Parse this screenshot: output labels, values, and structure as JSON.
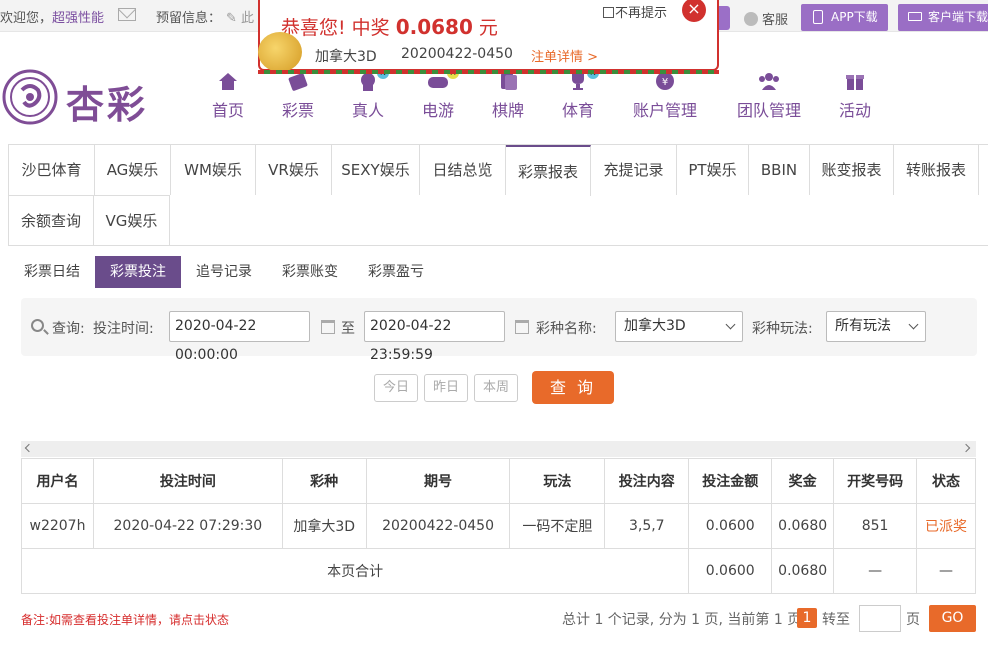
{
  "topbar": {
    "welcome": "欢迎您，",
    "username": "超强性能",
    "reserve_label": "预留信息：",
    "edit_partial": "✎ 此",
    "cs_label": "客服",
    "app_download": "APP下载",
    "client_download": "客户端下载"
  },
  "logo": {
    "text": "杏彩"
  },
  "nav": [
    {
      "label": "首页",
      "icon": "home-icon"
    },
    {
      "label": "彩票",
      "icon": "lottery-icon"
    },
    {
      "label": "真人",
      "icon": "live-casino-icon",
      "badge": "N"
    },
    {
      "label": "电游",
      "icon": "gamepad-icon",
      "badge": "H"
    },
    {
      "label": "棋牌",
      "icon": "cards-icon"
    },
    {
      "label": "体育",
      "icon": "trophy-icon",
      "badge": "N"
    },
    {
      "label": "账户管理",
      "icon": "coin-icon"
    },
    {
      "label": "团队管理",
      "icon": "team-icon"
    },
    {
      "label": "活动",
      "icon": "gift-icon"
    }
  ],
  "tabs": [
    "沙巴体育",
    "AG娱乐",
    "WM娱乐",
    "VR娱乐",
    "SEXY娱乐",
    "日结总览",
    "彩票报表",
    "充提记录",
    "PT娱乐",
    "BBIN",
    "账变报表",
    "转账报表",
    "余额查询",
    "VG娱乐"
  ],
  "active_tab": "彩票报表",
  "subtabs": [
    "彩票日结",
    "彩票投注",
    "追号记录",
    "彩票账变",
    "彩票盈亏"
  ],
  "active_subtab": "彩票投注",
  "query": {
    "label": "查询:",
    "time_label": "投注时间:",
    "start": "2020-04-22 00:00:00",
    "to": "至",
    "end": "2020-04-22 23:59:59",
    "lottery_label": "彩种名称:",
    "lottery_value": "加拿大3D",
    "play_label": "彩种玩法:",
    "play_value": "所有玩法"
  },
  "quick": {
    "today": "今日",
    "yesterday": "昨日",
    "week": "本周",
    "search": "查 询"
  },
  "table": {
    "headers": [
      "用户名",
      "投注时间",
      "彩种",
      "期号",
      "玩法",
      "投注内容",
      "投注金额",
      "奖金",
      "开奖号码",
      "状态"
    ],
    "rows": [
      [
        "w2207h",
        "2020-04-22 07:29:30",
        "加拿大3D",
        "20200422-0450",
        "一码不定胆",
        "3,5,7",
        "0.0600",
        "0.0680",
        "851",
        "已派奖"
      ]
    ],
    "total_label": "本页合计",
    "total_amount": "0.0600",
    "total_bonus": "0.0680",
    "total_draw": "—",
    "total_status": "—"
  },
  "note": "备注:如需查看投注单详情，请点击状态",
  "pager": {
    "summary": "总计 1 个记录, 分为 1 页, 当前第 1 页",
    "current": "1",
    "goto": "转至",
    "page_unit": "页",
    "go": "GO"
  },
  "popup": {
    "title_prefix": "恭喜您! 中奖 ",
    "amount": "0.0680",
    "unit": " 元",
    "no_more": "不再提示",
    "close": "×",
    "lottery": "加拿大3D",
    "issue": "20200422-0450",
    "detail_link": "注单详情 >"
  },
  "colors": {
    "brand_purple": "#7f4d96",
    "accent_orange": "#e86a2a",
    "popup_red": "#d1312e"
  }
}
